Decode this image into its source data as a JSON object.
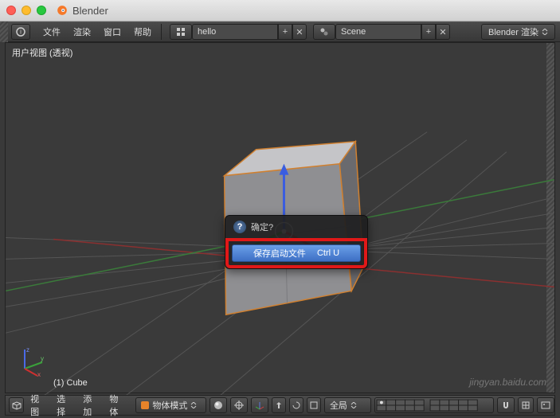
{
  "window": {
    "title": "Blender"
  },
  "menubar": {
    "items": [
      "文件",
      "渲染",
      "窗口",
      "帮助"
    ],
    "layout_field": "hello",
    "scene_field": "Scene",
    "render_engine": "Blender 渲染"
  },
  "viewport": {
    "header": "用户视图 (透视)",
    "object": "(1) Cube",
    "watermark": "jingyan.baidu.com",
    "axes": {
      "x": "x",
      "y": "y",
      "z": "z"
    }
  },
  "popup": {
    "title": "确定?",
    "button_label": "保存启动文件",
    "shortcut": "Ctrl U"
  },
  "bottombar": {
    "items": [
      "视图",
      "选择",
      "添加",
      "物体"
    ],
    "mode": "物体模式",
    "tool": "全局"
  }
}
